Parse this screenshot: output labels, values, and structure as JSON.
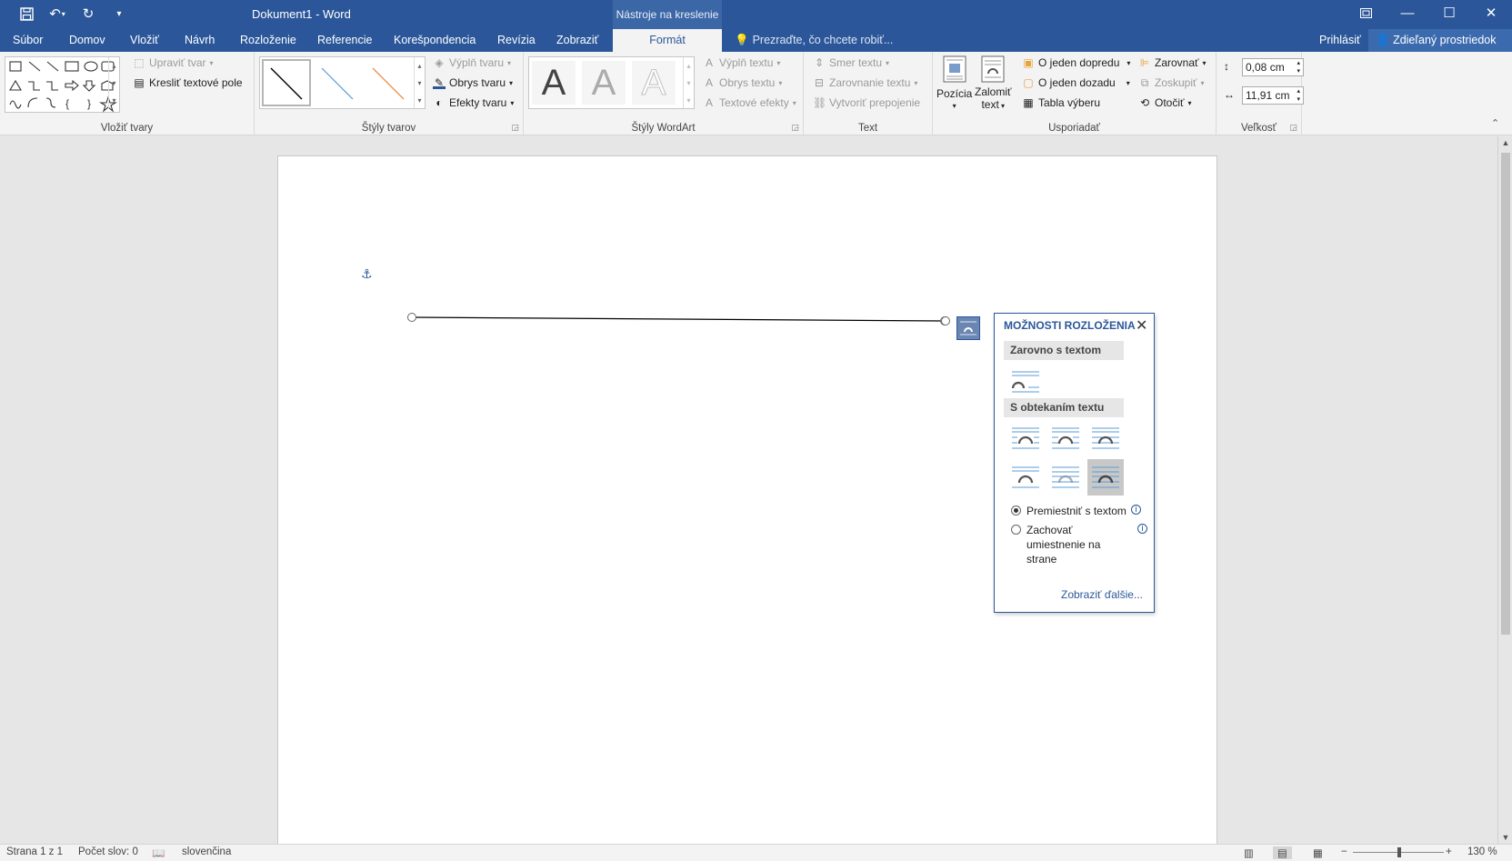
{
  "window": {
    "title": "Dokument1 - Word",
    "tools_header": "Nástroje na kreslenie",
    "controls": [
      "restore-icon",
      "minimize-icon",
      "maximize-icon",
      "close-icon"
    ]
  },
  "tabs": [
    "Súbor",
    "Domov",
    "Vložiť",
    "Návrh",
    "Rozloženie",
    "Referencie",
    "Korešpondencia",
    "Revízia",
    "Zobraziť",
    "Formát"
  ],
  "active_tab": "Formát",
  "tell_me": "Prezraďte, čo chcete robiť...",
  "sign_in": "Prihlásiť",
  "share": "Zdieľaný prostriedok",
  "ribbon": {
    "insert_shapes": {
      "label": "Vložiť tvary",
      "edit_shape": "Upraviť tvar",
      "draw_textbox": "Kresliť textové pole"
    },
    "shape_styles": {
      "label": "Štýly tvarov",
      "fill": "Výplň tvaru",
      "outline": "Obrys tvaru",
      "effects": "Efekty tvaru",
      "line_colors": [
        "#000000",
        "#5b9bd5",
        "#ed7d31"
      ]
    },
    "wordart": {
      "label": "Štýly WordArt",
      "letter": "A",
      "text_fill": "Výplň textu",
      "text_outline": "Obrys textu",
      "text_effects": "Textové efekty"
    },
    "text": {
      "label": "Text",
      "direction": "Smer textu",
      "align": "Zarovnanie textu",
      "link": "Vytvoriť prepojenie"
    },
    "arrange": {
      "label": "Usporiadať",
      "position": "Pozícia",
      "wrap_text_1": "Zalomiť",
      "wrap_text_2": "text",
      "bring_forward": "O jeden dopredu",
      "send_backward": "O jeden dozadu",
      "selection_pane": "Tabla výberu",
      "align": "Zarovnať",
      "group": "Zoskupiť",
      "rotate": "Otočiť"
    },
    "size": {
      "label": "Veľkosť",
      "height": "0,08 cm",
      "width": "11,91 cm"
    }
  },
  "layout_options": {
    "title": "MOŽNOSTI ROZLOŽENIA",
    "inline_section": "Zarovno s textom",
    "wrap_section": "S obtekaním textu",
    "radio_move": "Premiestniť s textom",
    "radio_fix_1": "Zachovať",
    "radio_fix_2": "umiestnenie na",
    "radio_fix_3": "strane",
    "see_more": "Zobraziť ďalšie..."
  },
  "status": {
    "page": "Strana 1 z 1",
    "words": "Počet slov: 0",
    "language": "slovenčina",
    "zoom": "130 %"
  },
  "colors": {
    "accent": "#2b579a"
  }
}
